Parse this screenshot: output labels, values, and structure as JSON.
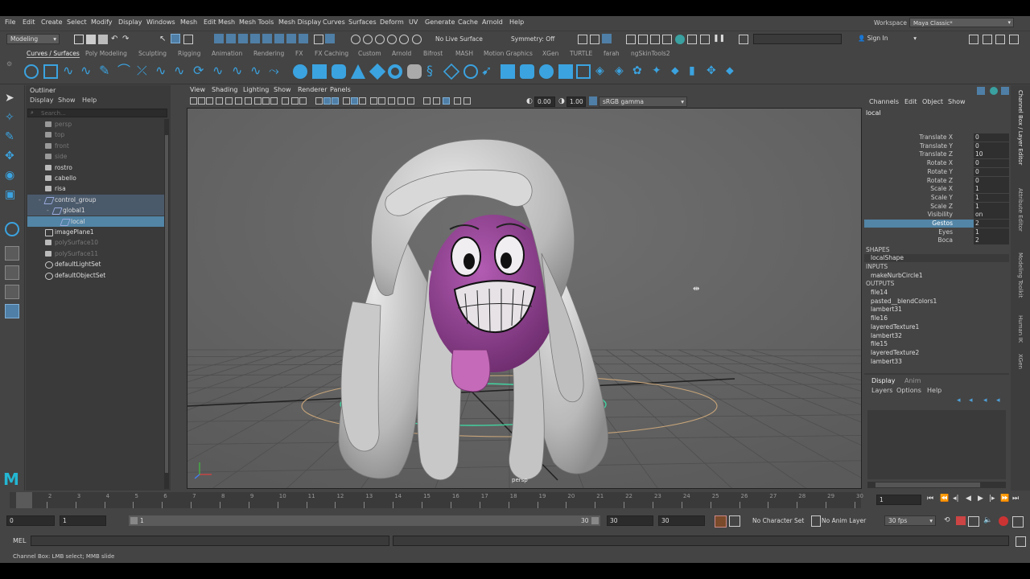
{
  "menubar": {
    "items": [
      "File",
      "Edit",
      "Create",
      "Select",
      "Modify",
      "Display",
      "Windows",
      "Mesh",
      "Edit Mesh",
      "Mesh Tools",
      "Mesh Display",
      "Curves",
      "Surfaces",
      "Deform",
      "UV",
      "Generate",
      "Cache",
      "Arnold",
      "Help"
    ],
    "workspace_label": "Workspace :",
    "workspace_value": "Maya Classic*"
  },
  "statusline": {
    "menu_set": "Modeling",
    "live_surface": "No Live Surface",
    "symmetry": "Symmetry: Off",
    "sign_in": "Sign In"
  },
  "shelf": {
    "tabs": [
      "Curves / Surfaces",
      "Poly Modeling",
      "Sculpting",
      "Rigging",
      "Animation",
      "Rendering",
      "FX",
      "FX Caching",
      "Custom",
      "Arnold",
      "Bifrost",
      "MASH",
      "Motion Graphics",
      "XGen",
      "TURTLE",
      "farah",
      "ngSkinTools2"
    ],
    "active_tab": "Curves / Surfaces"
  },
  "outliner": {
    "title": "Outliner",
    "menu": [
      "Display",
      "Show",
      "Help"
    ],
    "search_placeholder": "Search...",
    "items": [
      {
        "label": "persp",
        "type": "camera",
        "dim": true,
        "indent": 0
      },
      {
        "label": "top",
        "type": "camera",
        "dim": true,
        "indent": 0
      },
      {
        "label": "front",
        "type": "camera",
        "dim": true,
        "indent": 0
      },
      {
        "label": "side",
        "type": "camera",
        "dim": true,
        "indent": 0
      },
      {
        "label": "rostro",
        "type": "mesh",
        "dim": false,
        "indent": 0
      },
      {
        "label": "cabello",
        "type": "mesh",
        "dim": false,
        "indent": 0
      },
      {
        "label": "risa",
        "type": "mesh",
        "dim": false,
        "indent": 0
      },
      {
        "label": "control_group",
        "type": "curve",
        "dim": false,
        "indent": 0,
        "state": "highlight",
        "expand": "-"
      },
      {
        "label": "global1",
        "type": "curve",
        "dim": false,
        "indent": 1,
        "state": "highlight",
        "expand": "-"
      },
      {
        "label": "local",
        "type": "curve",
        "dim": false,
        "indent": 2,
        "state": "selected"
      },
      {
        "label": "imagePlane1",
        "type": "image",
        "dim": false,
        "indent": 0
      },
      {
        "label": "polySurface10",
        "type": "mesh",
        "dim": true,
        "indent": 0
      },
      {
        "label": "polySurface11",
        "type": "mesh",
        "dim": true,
        "indent": 0
      },
      {
        "label": "defaultLightSet",
        "type": "set",
        "dim": false,
        "indent": 0
      },
      {
        "label": "defaultObjectSet",
        "type": "set",
        "dim": false,
        "indent": 0
      }
    ]
  },
  "viewport": {
    "menu": [
      "View",
      "Shading",
      "Lighting",
      "Show",
      "Renderer",
      "Panels"
    ],
    "exposure": "0.00",
    "gamma": "1.00",
    "color_space": "sRGB gamma",
    "camera_label": "persp",
    "colors": {
      "background": "#676767",
      "body": "#b9b9b9",
      "face": "#8f3d8f",
      "tongue": "#c46ab8"
    }
  },
  "channelbox": {
    "menu": [
      "Channels",
      "Edit",
      "Object",
      "Show"
    ],
    "object": "local",
    "attributes": [
      {
        "name": "Translate X",
        "value": "0"
      },
      {
        "name": "Translate Y",
        "value": "0"
      },
      {
        "name": "Translate Z",
        "value": "10"
      },
      {
        "name": "Rotate X",
        "value": "0"
      },
      {
        "name": "Rotate Y",
        "value": "0"
      },
      {
        "name": "Rotate Z",
        "value": "0"
      },
      {
        "name": "Scale X",
        "value": "1"
      },
      {
        "name": "Scale Y",
        "value": "1"
      },
      {
        "name": "Scale Z",
        "value": "1"
      },
      {
        "name": "Visibility",
        "value": "on"
      },
      {
        "name": "Gestos",
        "value": "2",
        "selected": true
      },
      {
        "name": "Eyes",
        "value": "1"
      },
      {
        "name": "Boca",
        "value": "2"
      }
    ],
    "shapes_header": "SHAPES",
    "shapes": [
      "localShape"
    ],
    "inputs_header": "INPUTS",
    "inputs": [
      "makeNurbCircle1"
    ],
    "outputs_header": "OUTPUTS",
    "outputs": [
      "file14",
      "pasted__blendColors1",
      "lambert31",
      "file16",
      "layeredTexture1",
      "lambert32",
      "file15",
      "layeredTexture2",
      "lambert33"
    ],
    "side_tabs": [
      "Channel Box / Layer Editor",
      "Attribute Editor",
      "Modeling Toolkit",
      "Human IK",
      "XGen"
    ]
  },
  "layereditor": {
    "tabs": [
      "Display",
      "Anim"
    ],
    "menu": [
      "Layers",
      "Options",
      "Help"
    ]
  },
  "timeslider": {
    "ticks": [
      "1",
      "2",
      "3",
      "4",
      "5",
      "6",
      "7",
      "8",
      "9",
      "10",
      "11",
      "12",
      "13",
      "14",
      "15",
      "16",
      "17",
      "18",
      "19",
      "20",
      "21",
      "22",
      "23",
      "24",
      "25",
      "26",
      "27",
      "28",
      "29",
      "30"
    ],
    "current_frame": "1"
  },
  "rangeslider": {
    "start": "0",
    "inner_start": "1",
    "range_start": "1",
    "range_end": "30",
    "end_a": "30",
    "end_b": "30",
    "character_set": "No Character Set",
    "anim_layer": "No Anim Layer",
    "fps": "30 fps"
  },
  "cmdline": {
    "label": "MEL"
  },
  "helpline": {
    "text": "Channel Box: LMB select; MMB slide"
  }
}
